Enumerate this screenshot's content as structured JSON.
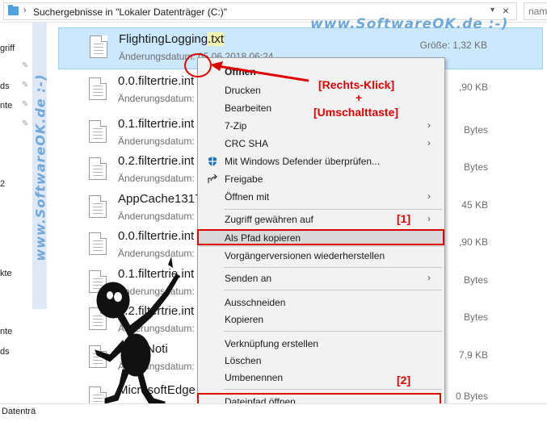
{
  "address": {
    "breadcrumb": "Suchergebnisse in \"Lokaler Datenträger (C:)\"",
    "search_placeholder": "nam"
  },
  "nav": {
    "items": [
      "griff",
      "ds",
      "nte",
      "2",
      "kte",
      "nte",
      "ds"
    ],
    "status_label": "Datenträ"
  },
  "watermark": {
    "top": "www.SoftwareOK.de :-)",
    "side": "www.SoftwareOK.de :-)"
  },
  "files": [
    {
      "name": "FlightingLogging",
      "ext": ".txt",
      "date": "Änderungsdatum: 05.06.2018 06:24",
      "size": "Größe: 1,32 KB"
    },
    {
      "name": "0.0.filtertrie.int",
      "ext": "",
      "date": "Änderungsdatum:",
      "size": ",90 KB"
    },
    {
      "name": "0.1.filtertrie.int",
      "ext": "",
      "date": "Änderungsdatum:",
      "size": "Bytes"
    },
    {
      "name": "0.2.filtertrie.int",
      "ext": "",
      "date": "Änderungsdatum:",
      "size": "Bytes"
    },
    {
      "name": "AppCache1317",
      "ext": "",
      "date": "Änderungsdatum:",
      "size": "45 KB"
    },
    {
      "name": "0.0.filtertrie.int",
      "ext": "",
      "date": "Änderungsdatum:",
      "size": ",90 KB"
    },
    {
      "name": "0.1.filtertrie.int",
      "ext": "",
      "date": "Änderungsdatum:",
      "size": "Bytes"
    },
    {
      "name": "0.2.filtertrie.int",
      "ext": "",
      "date": "Änderungsdatum:",
      "size": "Bytes"
    },
    {
      "name": "PartyNoti",
      "ext": "",
      "date": "Änderungsdatum:",
      "size": "7,9 KB"
    },
    {
      "name": "MicrosoftEdge",
      "ext": "",
      "date": "",
      "size": "0 Bytes"
    }
  ],
  "menu": {
    "items": [
      {
        "label": "Öffnen",
        "submenu": false
      },
      {
        "label": "Drucken",
        "submenu": false
      },
      {
        "label": "Bearbeiten",
        "submenu": false
      },
      {
        "label": "7-Zip",
        "submenu": true
      },
      {
        "label": "CRC SHA",
        "submenu": true
      },
      {
        "label": "Mit Windows Defender überprüfen...",
        "submenu": false
      },
      {
        "label": "Freigabe",
        "submenu": false
      },
      {
        "label": "Öffnen mit",
        "submenu": true
      },
      {
        "label": "Zugriff gewähren auf",
        "submenu": true
      },
      {
        "label": "Als Pfad kopieren",
        "submenu": false
      },
      {
        "label": "Vorgängerversionen wiederherstellen",
        "submenu": false
      },
      {
        "label": "Senden an",
        "submenu": true
      },
      {
        "label": "Ausschneiden",
        "submenu": false
      },
      {
        "label": "Kopieren",
        "submenu": false
      },
      {
        "label": "Verknüpfung erstellen",
        "submenu": false
      },
      {
        "label": "Löschen",
        "submenu": false
      },
      {
        "label": "Umbenennen",
        "submenu": false
      },
      {
        "label": "Dateipfad öffnen",
        "submenu": false
      }
    ],
    "highlighted": "Als Pfad kopieren"
  },
  "annotations": {
    "hint_line1": "[Rechts-Klick]",
    "hint_plus": "+",
    "hint_line2": "[Umschalttaste]",
    "marker1": "[1]",
    "marker2": "[2]"
  },
  "colors": {
    "selection": "#cce8ff",
    "annotation_red": "#e00000",
    "watermark_blue": "#6fa8dc",
    "menu_bg": "#f2f2f2"
  }
}
